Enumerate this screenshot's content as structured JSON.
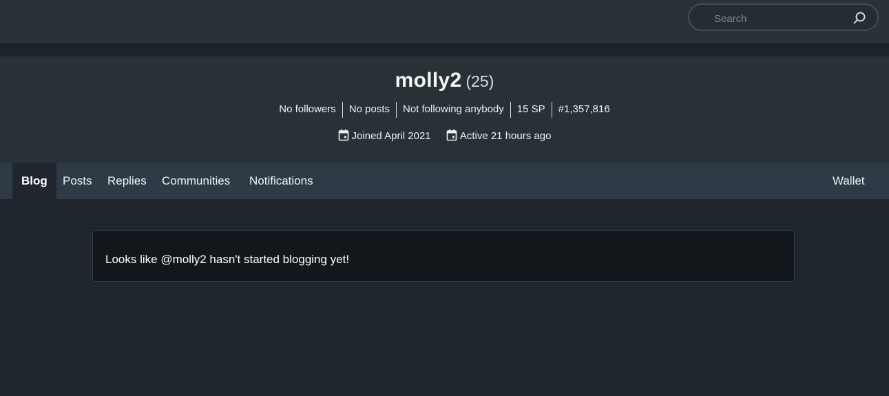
{
  "header": {
    "search": {
      "placeholder": "Search",
      "value": ""
    }
  },
  "profile": {
    "username": "molly2",
    "reputation": "(25)",
    "stats": [
      "No followers",
      "No posts",
      "Not following anybody",
      "15 SP",
      "#1,357,816"
    ],
    "joined": "Joined April 2021",
    "active": "Active 21 hours ago"
  },
  "tabs": {
    "blog": "Blog",
    "posts": "Posts",
    "replies": "Replies",
    "communities": "Communities",
    "notifications": "Notifications",
    "wallet": "Wallet",
    "active": "Blog"
  },
  "main": {
    "empty_message": "Looks like @molly2 hasn't started blogging yet!"
  },
  "colors": {
    "topbar": "#293237",
    "profile_bg": "#283236",
    "tabs_bg": "#2e3b47",
    "page_bg": "#1f262e",
    "card_bg": "#12171b"
  },
  "icons": {
    "search": "search-icon",
    "calendar": "calendar-icon"
  }
}
